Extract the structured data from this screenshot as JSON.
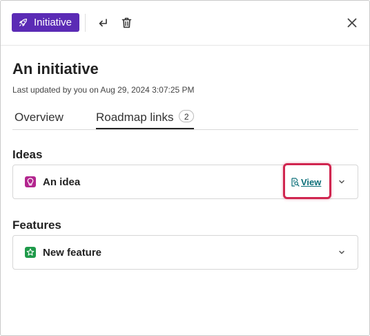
{
  "header": {
    "badge_label": "Initiative",
    "badge_color": "#5b2bb5",
    "badge_icon": "rocket-icon",
    "actions": [
      "enter-icon",
      "trash-icon"
    ],
    "close_icon": "close-icon"
  },
  "record": {
    "title": "An initiative",
    "updated": "Last updated by you on Aug 29, 2024 3:07:25 PM"
  },
  "tabs": [
    {
      "label": "Overview",
      "active": false
    },
    {
      "label": "Roadmap links",
      "count": "2",
      "active": true
    }
  ],
  "ideas": {
    "title": "Ideas",
    "items": [
      {
        "label": "An idea",
        "icon": "lightbulb-icon",
        "icon_color": "#b3268f",
        "action_label": "View",
        "action_icon": "document-search-icon"
      }
    ]
  },
  "features": {
    "title": "Features",
    "items": [
      {
        "label": "New feature",
        "icon": "star-icon",
        "icon_color": "#1f9a4a"
      }
    ]
  },
  "colors": {
    "link": "#0a6e78",
    "highlight": "#d0254f"
  }
}
